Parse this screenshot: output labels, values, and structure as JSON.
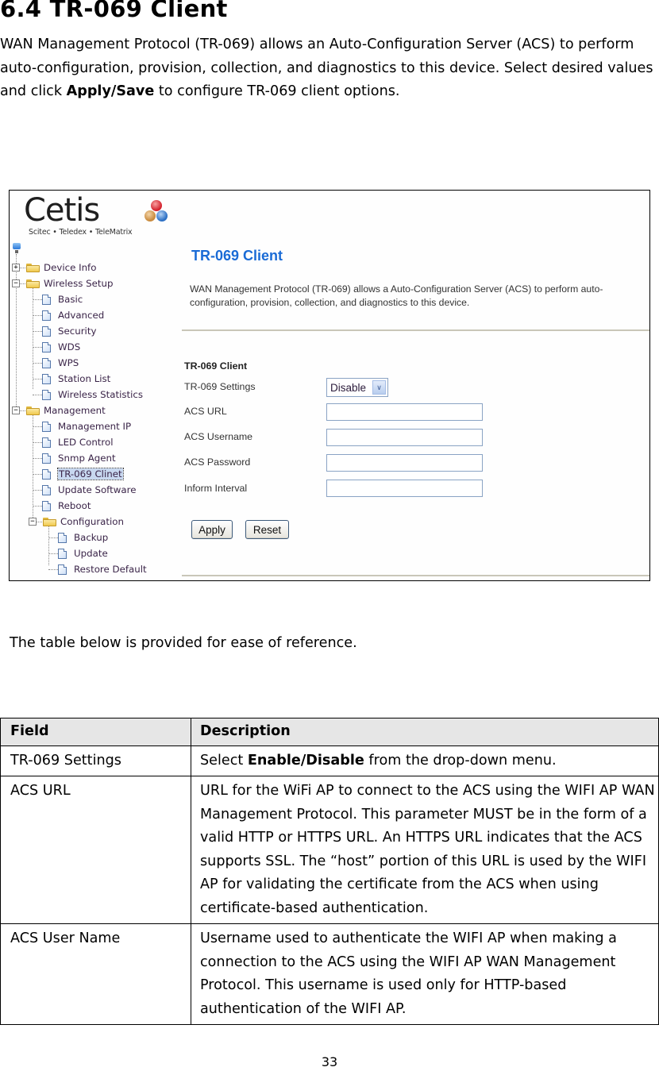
{
  "heading": "6.4 TR-069 Client",
  "intro": {
    "before": "WAN Management Protocol (TR-069) allows an Auto-Configuration Server (ACS) to perform auto-configuration, provision, collection, and diagnostics to this device.  Select desired values and click ",
    "bold": "Apply/Save",
    "after": " to configure TR-069 client options."
  },
  "screenshot": {
    "logo": {
      "wordmark": "Cetis",
      "tagline": "Scitec • Teledex • TeleMatrix"
    },
    "tree": {
      "groups": [
        {
          "label": "Device Info",
          "expanded": false,
          "children": []
        },
        {
          "label": "Wireless Setup",
          "expanded": true,
          "children": [
            "Basic",
            "Advanced",
            "Security",
            "WDS",
            "WPS",
            "Station List",
            "Wireless Statistics"
          ]
        },
        {
          "label": "Management",
          "expanded": true,
          "children": [
            "Management IP",
            "LED Control",
            "Snmp Agent",
            "TR-069 Clinet",
            "Update Software",
            "Reboot"
          ]
        },
        {
          "label": "Configuration",
          "expanded": true,
          "children": [
            "Backup",
            "Update",
            "Restore Default"
          ]
        }
      ],
      "selected": "TR-069 Clinet"
    },
    "pane": {
      "title": "TR-069 Client",
      "description": "WAN Management Protocol (TR-069) allows a Auto-Configuration Server (ACS) to perform auto-configuration, provision, collection, and diagnostics to this device.",
      "form_heading": "TR-069 Client",
      "fields": {
        "settings": {
          "label": "TR-069 Settings",
          "value": "Disable"
        },
        "acs_url": {
          "label": "ACS URL",
          "value": ""
        },
        "acs_username": {
          "label": "ACS Username",
          "value": ""
        },
        "acs_password": {
          "label": "ACS Password",
          "value": ""
        },
        "inform_interval": {
          "label": "Inform Interval",
          "value": ""
        }
      },
      "buttons": {
        "apply": "Apply",
        "reset": "Reset"
      }
    }
  },
  "reference_text": "The table below is provided for ease of reference.",
  "table": {
    "headers": {
      "field": "Field",
      "description": "Description"
    },
    "rows": [
      {
        "field": "TR-069 Settings",
        "desc_before": "Select ",
        "desc_bold": "Enable/Disable",
        "desc_after": " from the drop-down menu."
      },
      {
        "field": "ACS URL",
        "desc_before": "URL for the WiFi AP  to connect to the ACS using the WIFI AP   WAN Management Protocol. This parameter MUST be in the form of a valid HTTP or HTTPS URL. An HTTPS URL indicates that the ACS supports SSL. The “host” portion of this URL is used by the WIFI AP   for validating the certificate from the ACS when using certificate-based authentication.",
        "desc_bold": "",
        "desc_after": ""
      },
      {
        "field": "ACS User Name",
        "desc_before": "Username used to authenticate the WIFI AP   when making a connection to the ACS using the WIFI AP WAN Management Protocol. This username is used only for HTTP-based authentication of the WIFI AP.",
        "desc_bold": "",
        "desc_after": ""
      }
    ]
  },
  "page_number": "33"
}
